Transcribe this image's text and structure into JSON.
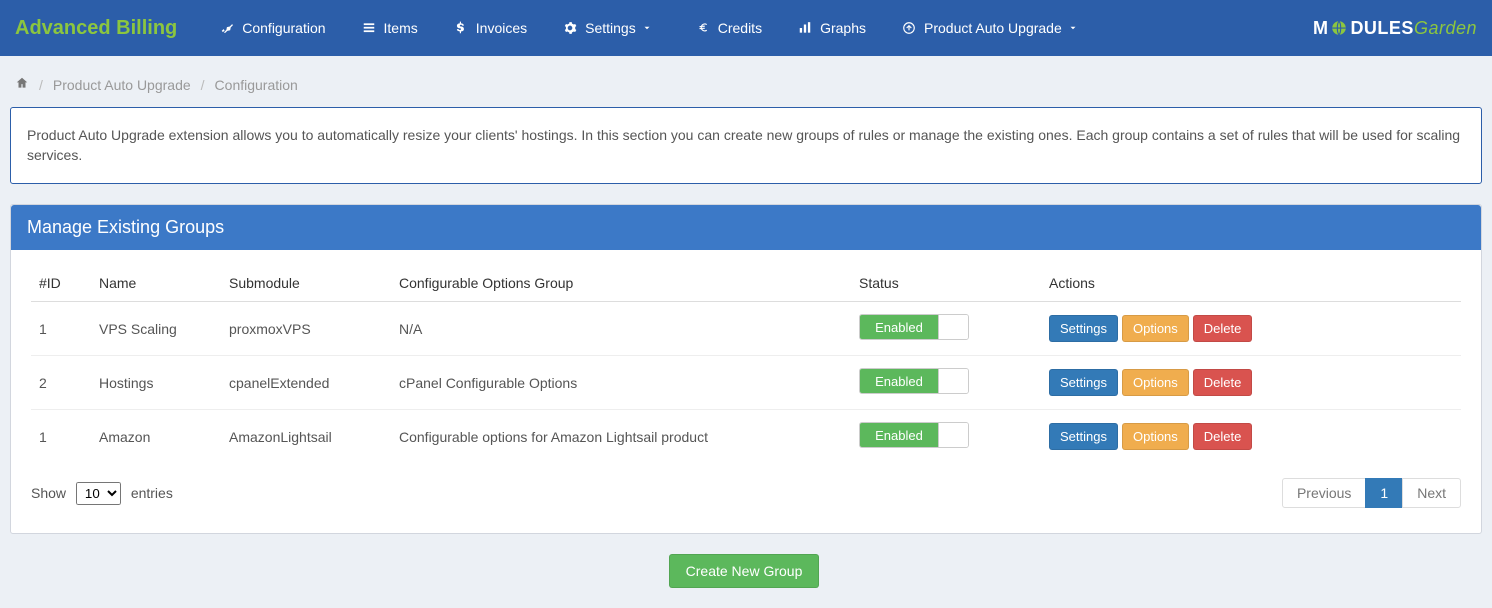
{
  "brand": "Advanced Billing",
  "nav": {
    "configuration": "Configuration",
    "items": "Items",
    "invoices": "Invoices",
    "settings": "Settings",
    "credits": "Credits",
    "graphs": "Graphs",
    "product_auto_upgrade": "Product Auto Upgrade"
  },
  "logo": {
    "part1": "M",
    "part2": "DULES",
    "part3": "Garden"
  },
  "breadcrumb": {
    "product_auto_upgrade": "Product Auto Upgrade",
    "configuration": "Configuration"
  },
  "info_text": "Product Auto Upgrade extension allows you to automatically resize your clients' hostings. In this section you can create new groups of rules or manage the existing ones. Each group contains a set of rules that will be used for scaling services.",
  "panel_title": "Manage Existing Groups",
  "table": {
    "headers": {
      "id": "#ID",
      "name": "Name",
      "submodule": "Submodule",
      "config_group": "Configurable Options Group",
      "status": "Status",
      "actions": "Actions"
    },
    "rows": [
      {
        "id": "1",
        "name": "VPS Scaling",
        "submodule": "proxmoxVPS",
        "config_group": "N/A",
        "status": "Enabled"
      },
      {
        "id": "2",
        "name": "Hostings",
        "submodule": "cpanelExtended",
        "config_group": "cPanel Configurable Options",
        "status": "Enabled"
      },
      {
        "id": "1",
        "name": "Amazon",
        "submodule": "AmazonLightsail",
        "config_group": "Configurable options for Amazon Lightsail product",
        "status": "Enabled"
      }
    ]
  },
  "actions": {
    "settings": "Settings",
    "options": "Options",
    "delete": "Delete"
  },
  "footer": {
    "show": "Show",
    "entries": "entries",
    "page_size": "10",
    "previous": "Previous",
    "page": "1",
    "next": "Next"
  },
  "create_button": "Create New Group"
}
